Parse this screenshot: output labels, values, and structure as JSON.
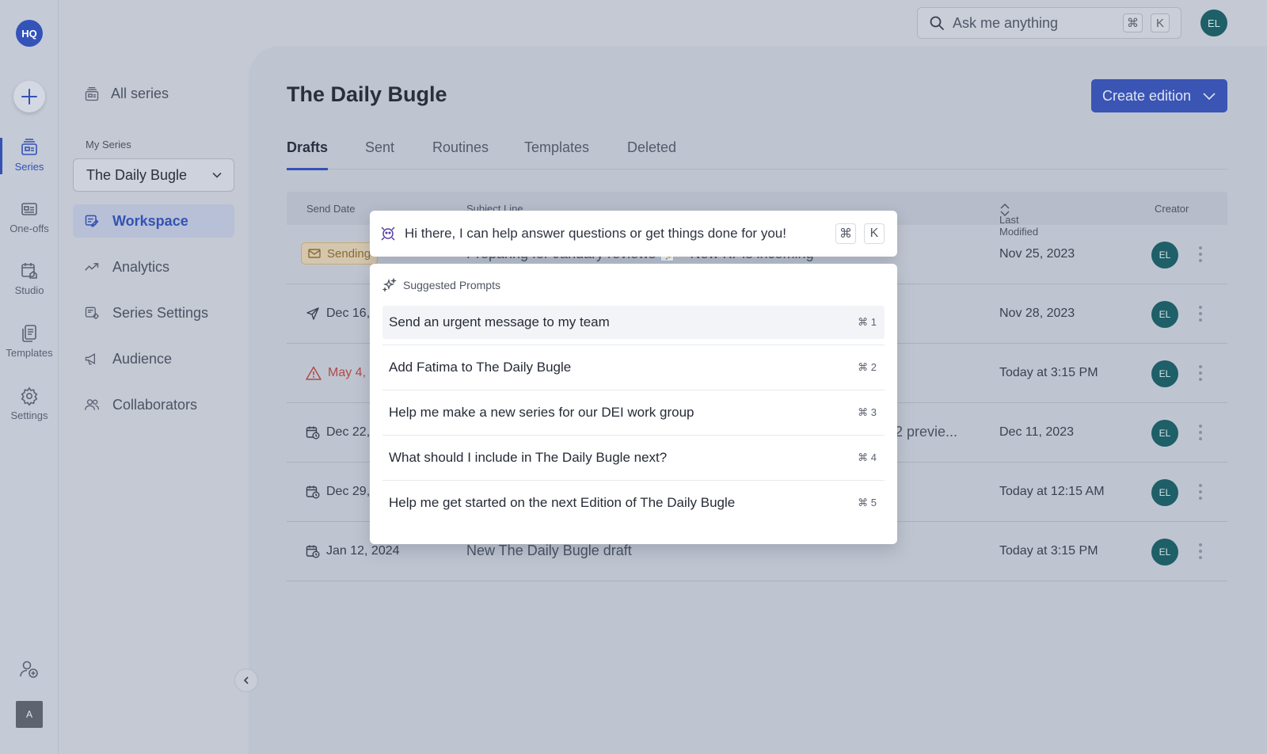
{
  "rail": {
    "logo": "HQ",
    "items": [
      {
        "label": "Series",
        "icon": "series-icon",
        "active": true
      },
      {
        "label": "One-offs",
        "icon": "one-offs-icon"
      },
      {
        "label": "Studio",
        "icon": "studio-icon"
      },
      {
        "label": "Templates",
        "icon": "templates-icon"
      },
      {
        "label": "Settings",
        "icon": "gear-icon"
      }
    ],
    "user_initial": "A"
  },
  "subnav": {
    "all_series": "All series",
    "heading": "My Series",
    "selected_series": "The Daily Bugle",
    "items": [
      {
        "label": "Workspace",
        "icon": "workspace-icon",
        "active": true
      },
      {
        "label": "Analytics",
        "icon": "analytics-icon"
      },
      {
        "label": "Series Settings",
        "icon": "series-settings-icon"
      },
      {
        "label": "Audience",
        "icon": "megaphone-icon"
      },
      {
        "label": "Collaborators",
        "icon": "users-icon"
      }
    ]
  },
  "topbar": {
    "search_placeholder": "Ask me anything",
    "shortcut_cmd": "⌘",
    "shortcut_key": "K",
    "avatar": "EL"
  },
  "main": {
    "title": "The Daily Bugle",
    "create_button": "Create edition",
    "tabs": [
      "Drafts",
      "Sent",
      "Routines",
      "Templates",
      "Deleted"
    ],
    "active_tab": "Drafts",
    "columns": {
      "send_date": "Send Date",
      "subject": "Subject Line",
      "modified": "Last Modified",
      "creator": "Creator"
    },
    "rows": [
      {
        "date": "Sending",
        "status": "sending",
        "subject": "Preparing for January reviews 📝 - New KPIs incoming",
        "modified": "Nov 25, 2023",
        "creator": "EL"
      },
      {
        "date": "Dec 16,",
        "status": "sent",
        "subject": "",
        "modified": "Nov 28, 2023",
        "creator": "EL"
      },
      {
        "date": "May 4, 2",
        "status": "error",
        "subject": "",
        "modified": "Today at 3:15 PM",
        "creator": "EL"
      },
      {
        "date": "Dec 22,",
        "status": "scheduled",
        "subject": "2 previe...",
        "modified": "Dec 11, 2023",
        "creator": "EL"
      },
      {
        "date": "Dec 29,",
        "status": "scheduled",
        "subject": "",
        "modified": "Today at 12:15 AM",
        "creator": "EL"
      },
      {
        "date": "Jan 12, 2024",
        "status": "scheduled",
        "subject": "New The Daily Bugle draft",
        "modified": "Today at 3:15 PM",
        "creator": "EL"
      }
    ]
  },
  "assistant": {
    "greeting": "Hi there, I can help answer questions or get things done for you!",
    "shortcut_cmd": "⌘",
    "shortcut_key": "K",
    "suggested_heading": "Suggested Prompts",
    "prompts": [
      {
        "text": "Send an urgent message to my team",
        "shortcut": "⌘ 1"
      },
      {
        "text": "Add Fatima to The Daily Bugle",
        "shortcut": "⌘ 2"
      },
      {
        "text": "Help me make a new series for our DEI work group",
        "shortcut": "⌘ 3"
      },
      {
        "text": "What should I include in The Daily Bugle next?",
        "shortcut": "⌘ 4"
      },
      {
        "text": "Help me get started on the next Edition of The Daily Bugle",
        "shortcut": "⌘ 5"
      }
    ]
  },
  "colors": {
    "accent": "#3452b4",
    "avatar": "#1e5f68",
    "warning": "#b14a4a",
    "sending": "#8a6a34"
  }
}
